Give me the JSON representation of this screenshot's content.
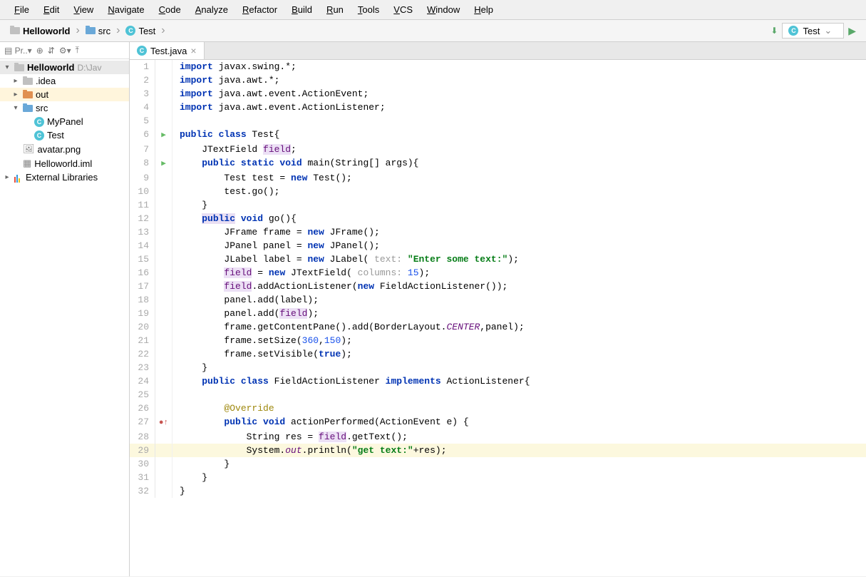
{
  "menu": [
    "File",
    "Edit",
    "View",
    "Navigate",
    "Code",
    "Analyze",
    "Refactor",
    "Build",
    "Run",
    "Tools",
    "VCS",
    "Window",
    "Help"
  ],
  "breadcrumb": {
    "project": "Helloworld",
    "folder": "src",
    "file": "Test"
  },
  "runConfig": "Test",
  "projectTree": {
    "root": {
      "name": "Helloworld",
      "path": "D:\\Jav"
    },
    "idea": ".idea",
    "out": "out",
    "src": "src",
    "myPanel": "MyPanel",
    "test": "Test",
    "avatar": "avatar.png",
    "iml": "Helloworld.iml",
    "extLib": "External Libraries"
  },
  "tab": {
    "name": "Test.java"
  },
  "lines": [
    {
      "n": 1,
      "html": "<span class='kw'>import</span> javax.swing.*;"
    },
    {
      "n": 2,
      "html": "<span class='kw'>import</span> java.awt.*;"
    },
    {
      "n": 3,
      "html": "<span class='kw'>import</span> java.awt.event.ActionEvent;"
    },
    {
      "n": 4,
      "html": "<span class='kw'>import</span> java.awt.event.ActionListener;"
    },
    {
      "n": 5,
      "html": ""
    },
    {
      "n": 6,
      "html": "<span class='kw'>public class</span> Test{",
      "marker": "▶"
    },
    {
      "n": 7,
      "html": "    JTextField <span class='fld'>field</span>;"
    },
    {
      "n": 8,
      "html": "    <span class='kw'>public static void</span> main(String[] args){",
      "marker": "▶"
    },
    {
      "n": 9,
      "html": "        Test test = <span class='kw'>new</span> Test();"
    },
    {
      "n": 10,
      "html": "        test.go();"
    },
    {
      "n": 11,
      "html": "    }"
    },
    {
      "n": 12,
      "html": "    <span class='hl-purple'><span class='kw'>public</span></span> <span class='kw'>void</span> go(){"
    },
    {
      "n": 13,
      "html": "        JFrame frame = <span class='kw'>new</span> JFrame();"
    },
    {
      "n": 14,
      "html": "        JPanel panel = <span class='kw'>new</span> JPanel();"
    },
    {
      "n": 15,
      "html": "        JLabel label = <span class='kw'>new</span> JLabel( <span class='hint'>text:</span> <span class='str'>\"Enter some text:\"</span>);"
    },
    {
      "n": 16,
      "html": "        <span class='fld'>field</span> = <span class='kw'>new</span> JTextField( <span class='hint'>columns:</span> <span class='num'>15</span>);"
    },
    {
      "n": 17,
      "html": "        <span class='fld'>field</span>.addActionListener(<span class='kw'>new</span> FieldActionListener());"
    },
    {
      "n": 18,
      "html": "        panel.add(label);"
    },
    {
      "n": 19,
      "html": "        panel.add(<span class='fld'>field</span>);"
    },
    {
      "n": 20,
      "html": "        frame.getContentPane().add(BorderLayout.<span class='sit'>CENTER</span>,panel);"
    },
    {
      "n": 21,
      "html": "        frame.setSize(<span class='num'>360</span>,<span class='num'>150</span>);"
    },
    {
      "n": 22,
      "html": "        frame.setVisible(<span class='kw'>true</span>);"
    },
    {
      "n": 23,
      "html": "    }"
    },
    {
      "n": 24,
      "html": "    <span class='kw'>public class</span> FieldActionListener <span class='kw'>implements</span> ActionListener{"
    },
    {
      "n": 25,
      "html": ""
    },
    {
      "n": 26,
      "html": "        <span class='ann'>@Override</span>"
    },
    {
      "n": 27,
      "html": "        <span class='kw'>public void</span> actionPerformed(ActionEvent e) {",
      "marker": "●↑"
    },
    {
      "n": 28,
      "html": "            String res = <span class='fld'>field</span>.getText();"
    },
    {
      "n": 29,
      "html": "            System.<span class='sit'>out</span>.println(<span class='str'>\"get text:\"</span>+res);",
      "current": true
    },
    {
      "n": 30,
      "html": "        }"
    },
    {
      "n": 31,
      "html": "    }"
    },
    {
      "n": 32,
      "html": "}"
    }
  ]
}
